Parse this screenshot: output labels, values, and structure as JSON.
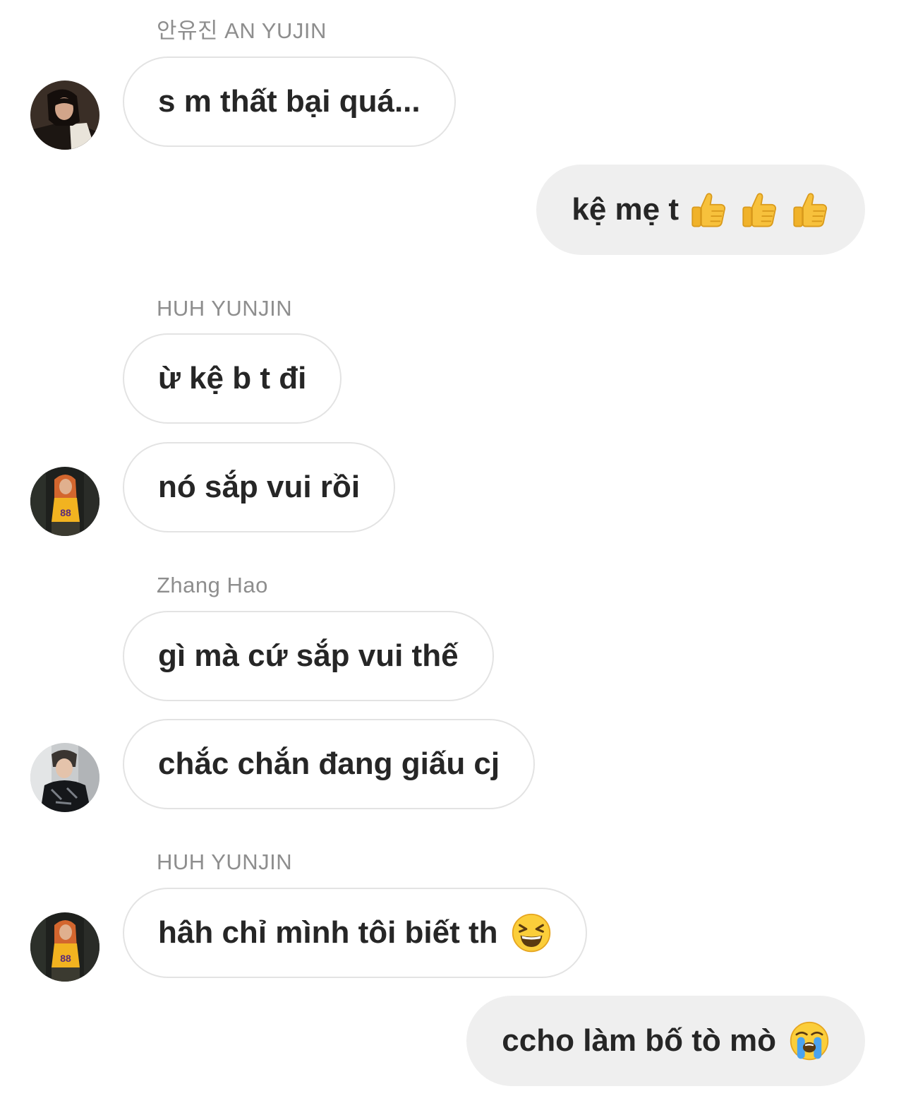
{
  "messages": [
    {
      "sender_label": "안유진 AN YUJIN",
      "text": "s m thất bại quá...",
      "direction": "incoming",
      "avatar": "avatar-an-yujin"
    },
    {
      "text": "kệ mẹ t",
      "direction": "outgoing",
      "emojis": [
        "thumbs-up-icon",
        "thumbs-up-icon",
        "thumbs-up-icon"
      ]
    },
    {
      "sender_label": "HUH YUNJIN",
      "text": "ừ kệ b t đi",
      "direction": "incoming"
    },
    {
      "text": "nó sắp vui rồi",
      "direction": "incoming",
      "avatar": "avatar-huh-yunjin"
    },
    {
      "sender_label": "Zhang Hao",
      "text": "gì mà cứ sắp vui thế",
      "direction": "incoming"
    },
    {
      "text": "chắc chắn đang giấu cj",
      "direction": "incoming",
      "avatar": "avatar-zhang-hao"
    },
    {
      "sender_label": "HUH YUNJIN",
      "text": "hâh chỉ mình tôi biết th",
      "direction": "incoming",
      "avatar": "avatar-huh-yunjin",
      "emojis": [
        "grinning-squinting-face-icon"
      ]
    },
    {
      "text": "ccho làm bố tò mò",
      "direction": "outgoing",
      "emojis": [
        "loudly-crying-face-icon"
      ]
    }
  ],
  "colors": {
    "background": "#ffffff",
    "incoming_border": "#e3e3e3",
    "outgoing_fill": "#efefef",
    "text": "#262626",
    "sender_label": "#8e8e8e"
  }
}
